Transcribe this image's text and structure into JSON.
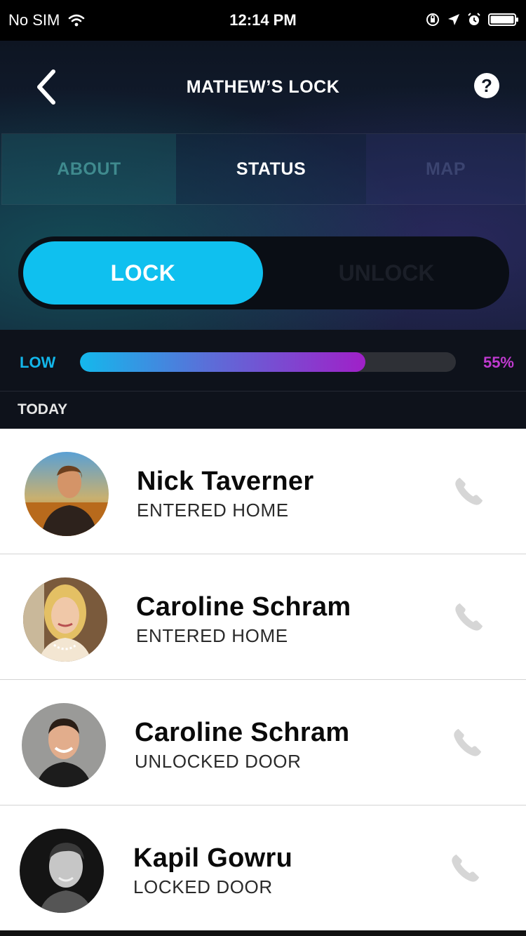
{
  "status_bar": {
    "carrier": "No SIM",
    "time": "12:14 PM",
    "icons": [
      "wifi-icon",
      "orientation-lock-icon",
      "location-icon",
      "alarm-icon",
      "battery-icon"
    ]
  },
  "header": {
    "title": "MATHEW’S LOCK",
    "back_icon": "chevron-left-icon",
    "help_label": "?"
  },
  "tabs": [
    {
      "label": "ABOUT",
      "active": false
    },
    {
      "label": "STATUS",
      "active": true
    },
    {
      "label": "MAP",
      "active": false
    }
  ],
  "lock_toggle": {
    "lock_label": "LOCK",
    "unlock_label": "UNLOCK",
    "selected": "LOCK"
  },
  "battery": {
    "low_label": "LOW",
    "percent_label": "55%",
    "level": 0.55
  },
  "section_label": "TODAY",
  "activity": [
    {
      "name": "Nick Taverner",
      "action": "ENTERED HOME",
      "icon": "phone-icon"
    },
    {
      "name": "Caroline Schram",
      "action": "ENTERED HOME",
      "icon": "phone-icon"
    },
    {
      "name": "Caroline Schram",
      "action": "UNLOCKED DOOR",
      "icon": "phone-icon"
    },
    {
      "name": "Kapil Gowru",
      "action": "LOCKED DOOR",
      "icon": "phone-icon"
    }
  ],
  "colors": {
    "accent": "#0fc0ef",
    "battery_low": "#12b6ea",
    "battery_pct": "#c03ad0"
  }
}
